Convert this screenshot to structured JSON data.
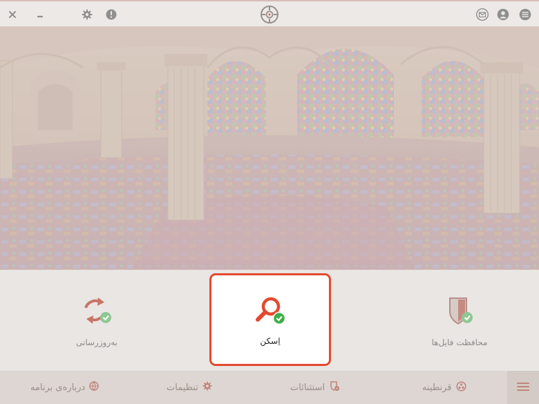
{
  "titlebar": {
    "close_icon": "close-icon",
    "minimize_icon": "minimize-icon",
    "settings_icon": "gear-icon",
    "info_icon": "info-icon",
    "logo_icon": "crosshair-logo-icon",
    "mail_icon": "mail-icon",
    "account_icon": "user-icon",
    "menu_icon": "hamburger-menu-icon"
  },
  "features": {
    "scan": {
      "label": "اِسکن",
      "icon": "magnifier-check-icon",
      "selected": true
    },
    "protect": {
      "label": "محافظت فایل‌ها",
      "icon": "shield-check-icon"
    },
    "update": {
      "label": "به‌روزرسانی",
      "icon": "refresh-check-icon"
    }
  },
  "bottomnav": {
    "menu_icon": "hamburger-menu-icon",
    "items": [
      {
        "label": "قرنطینه",
        "icon": "biohazard-icon"
      },
      {
        "label": "استثنائات",
        "icon": "exception-shield-icon"
      },
      {
        "label": "تنظیمات",
        "icon": "gear-icon"
      },
      {
        "label": "درباره‌ی برنامه",
        "icon": "globe-icon"
      }
    ]
  },
  "colors": {
    "accent": "#e4492f",
    "success": "#3fae49",
    "muted_icon": "#9c9c9c",
    "nav_background": "#ddd6d2"
  }
}
